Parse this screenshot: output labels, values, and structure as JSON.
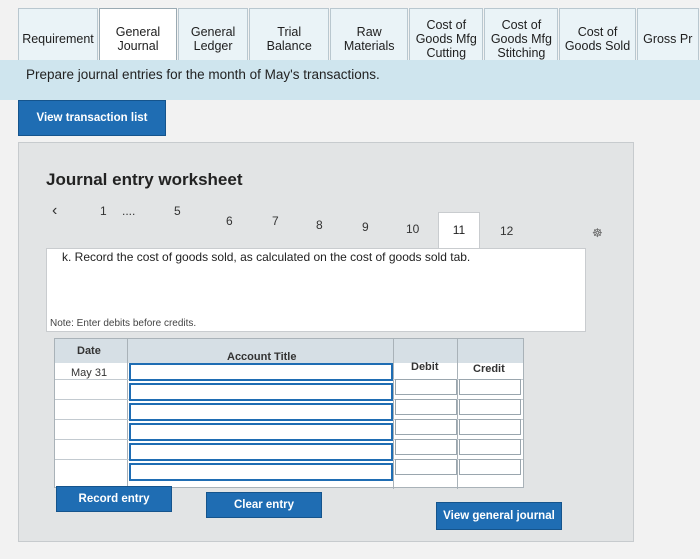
{
  "tabs": [
    {
      "label": "Requirement",
      "width": 82,
      "active": false
    },
    {
      "label": "General\nJournal",
      "width": 80,
      "active": true
    },
    {
      "label": "General\nLedger",
      "width": 72,
      "active": false
    },
    {
      "label": "Trial Balance",
      "width": 82,
      "active": false
    },
    {
      "label": "Raw\nMaterials",
      "width": 80,
      "active": false
    },
    {
      "label": "Cost of\nGoods Mfg\nCutting",
      "width": 76,
      "active": false
    },
    {
      "label": "Cost of\nGoods Mfg\nStitching",
      "width": 76,
      "active": false
    },
    {
      "label": "Cost of\nGoods Sold",
      "width": 78,
      "active": false
    },
    {
      "label": "Gross Pr",
      "width": 64,
      "active": false
    }
  ],
  "instruction": "Prepare journal entries for the month of May's transactions.",
  "buttons": {
    "view_transactions": "View transaction list",
    "record_entry": "Record entry",
    "clear_entry": "Clear entry",
    "view_general_journal": "View general journal"
  },
  "worksheet": {
    "title": "Journal entry worksheet",
    "prev_icon": "chevron-left-icon",
    "pages": [
      "1",
      "....",
      "5",
      "6",
      "7",
      "8",
      "9",
      "10",
      "11",
      "12"
    ],
    "active_page": "11",
    "task": "k. Record the cost of goods sold, as calculated on the cost of goods sold tab.",
    "note": "Note: Enter debits before credits."
  },
  "table": {
    "headers": {
      "date": "Date",
      "account": "Account Title",
      "debit": "Debit",
      "credit": "Credit"
    },
    "rows": [
      {
        "date": "May 31"
      },
      {
        "date": ""
      },
      {
        "date": ""
      },
      {
        "date": ""
      },
      {
        "date": ""
      },
      {
        "date": ""
      }
    ]
  },
  "colors": {
    "accent": "#1f6db3",
    "tab_bar": "#cfe5ee"
  }
}
